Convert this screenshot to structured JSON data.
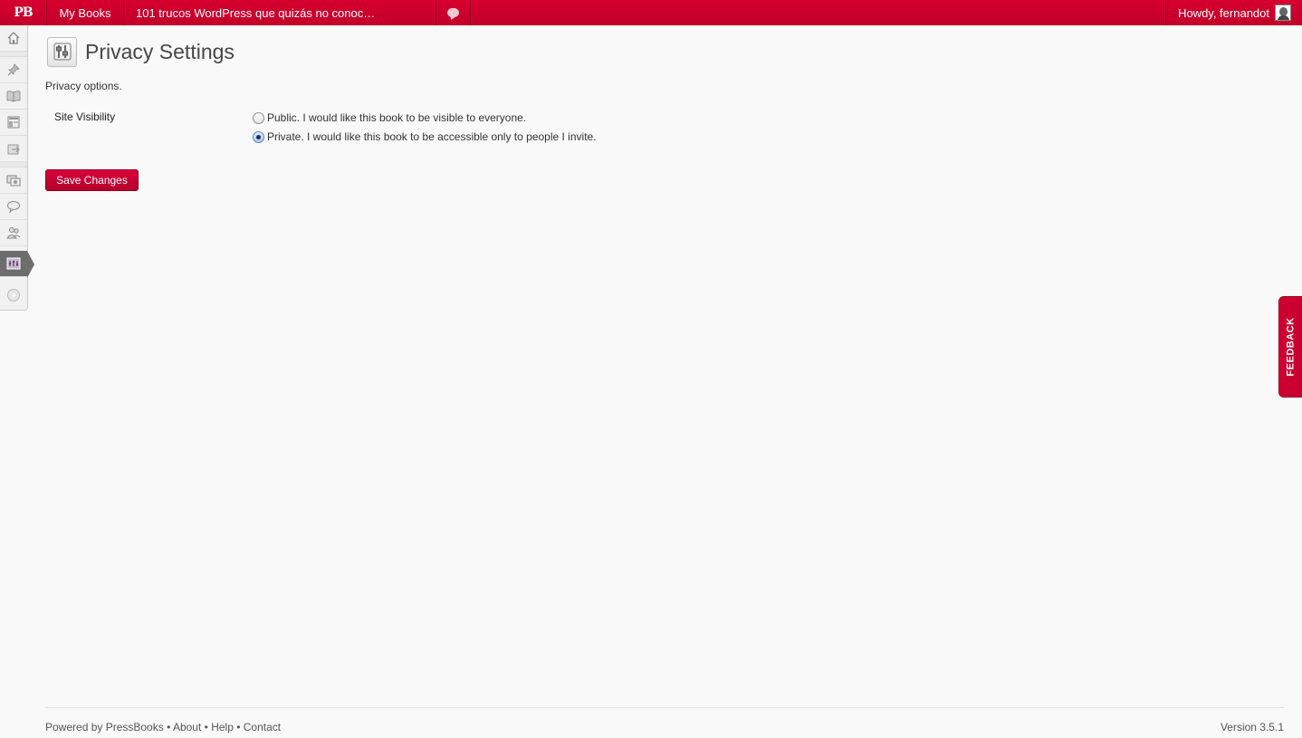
{
  "adminbar": {
    "logo": "PB",
    "my_books": "My Books",
    "site_name": "101 trucos WordPress que quizás no conoc…",
    "howdy": "Howdy, fernandot"
  },
  "sidemenu": {
    "items": [
      "dashboard-icon",
      "pin-icon",
      "book-icon",
      "layout-icon",
      "export-icon",
      "media-icon",
      "comments-icon",
      "users-icon",
      "settings-icon",
      "collapse-icon"
    ],
    "current": "settings-icon"
  },
  "page": {
    "title": "Privacy Settings",
    "intro": "Privacy options.",
    "visibility_label": "Site Visibility",
    "options": [
      {
        "label": "Public. I would like this book to be visible to everyone.",
        "checked": false
      },
      {
        "label": "Private. I would like this book to be accessible only to people I invite.",
        "checked": true
      }
    ],
    "save_label": "Save Changes"
  },
  "footer": {
    "powered_prefix": "Powered by ",
    "powered_link": "PressBooks",
    "sep": " • ",
    "about": "About",
    "help": "Help",
    "contact": "Contact",
    "version": "Version 3.5.1"
  },
  "feedback": "FEEDBACK",
  "colors": {
    "brand": "#c8002d",
    "background": "#f9f9f9"
  }
}
